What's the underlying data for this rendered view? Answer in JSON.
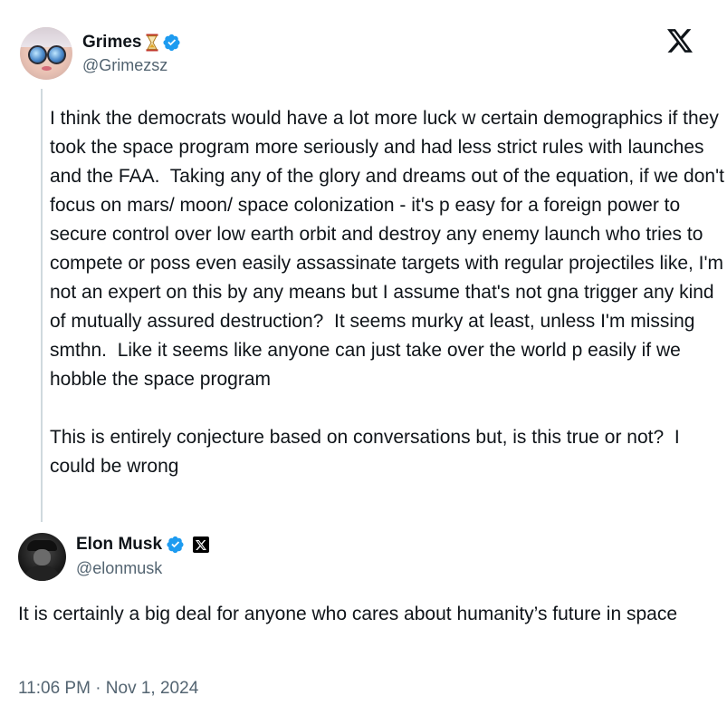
{
  "parent_tweet": {
    "author": {
      "display_name": "Grimes",
      "handle": "@Grimezsz",
      "name_emoji_icon": "hourglass-icon",
      "verified": true,
      "verified_color": "#1d9bf0"
    },
    "text": "I think the democrats would have a lot more luck w certain demographics if they took the space program more seriously and had less strict rules with launches and the FAA.  Taking any of the glory and dreams out of the equation, if we don't focus on mars/ moon/ space colonization - it's p easy for a foreign power to secure control over low earth orbit and destroy any enemy launch who tries to compete or poss even easily assassinate targets with regular projectiles like, I'm not an expert on this by any means but I assume that's not gna trigger any kind of mutually assured destruction?  It seems murky at least, unless I'm missing smthn.  Like it seems like anyone can just take over the world p easily if we hobble the space program\n\nThis is entirely conjecture based on conversations but, is this true or not?  I could be wrong"
  },
  "reply_tweet": {
    "author": {
      "display_name": "Elon Musk",
      "handle": "@elonmusk",
      "verified": true,
      "verified_color": "#1d9bf0",
      "affiliate_badge_icon": "x-affiliation-icon"
    },
    "text": "It is certainly a big deal for anyone who cares about humanity’s future in space",
    "timestamp": "11:06 PM · Nov 1, 2024"
  },
  "brand": {
    "logo_icon": "x-logo-icon"
  },
  "colors": {
    "text_primary": "#0f1419",
    "text_secondary": "#536471",
    "thread_line": "#cfd9de",
    "accent": "#1d9bf0"
  }
}
